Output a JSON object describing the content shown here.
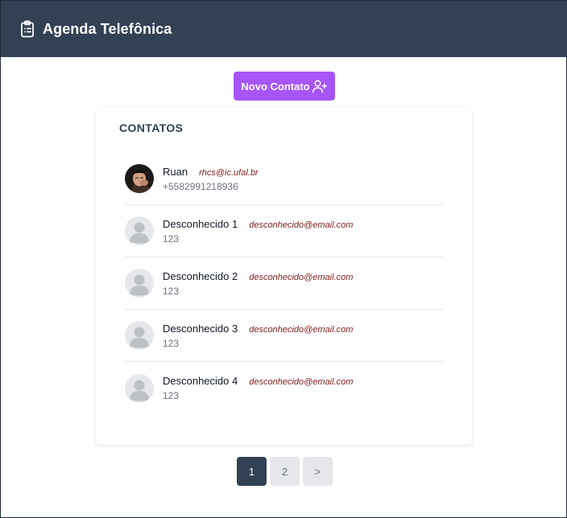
{
  "header": {
    "title": "Agenda Telefônica",
    "icon": "clipboard-list-icon"
  },
  "new_contact": {
    "label": "Novo Contato",
    "icon": "user-plus-icon",
    "color": "#a855f7"
  },
  "contacts": {
    "title": "CONTATOS",
    "items": [
      {
        "name": "Ruan",
        "email": "rhcs@ic.ufal.br",
        "phone": "+5582991218936",
        "avatar": "photo"
      },
      {
        "name": "Desconhecido 1",
        "email": "desconhecido@email.com",
        "phone": "123",
        "avatar": "default-user"
      },
      {
        "name": "Desconhecido 2",
        "email": "desconhecido@email.com",
        "phone": "123",
        "avatar": "default-user"
      },
      {
        "name": "Desconhecido 3",
        "email": "desconhecido@email.com",
        "phone": "123",
        "avatar": "default-user"
      },
      {
        "name": "Desconhecido 4",
        "email": "desconhecido@email.com",
        "phone": "123",
        "avatar": "default-user"
      }
    ]
  },
  "pagination": {
    "pages": [
      "1",
      "2"
    ],
    "current": "1",
    "next_label": ">"
  },
  "colors": {
    "header_bg": "#334155",
    "accent": "#a855f7",
    "email": "#7f1d1d"
  }
}
